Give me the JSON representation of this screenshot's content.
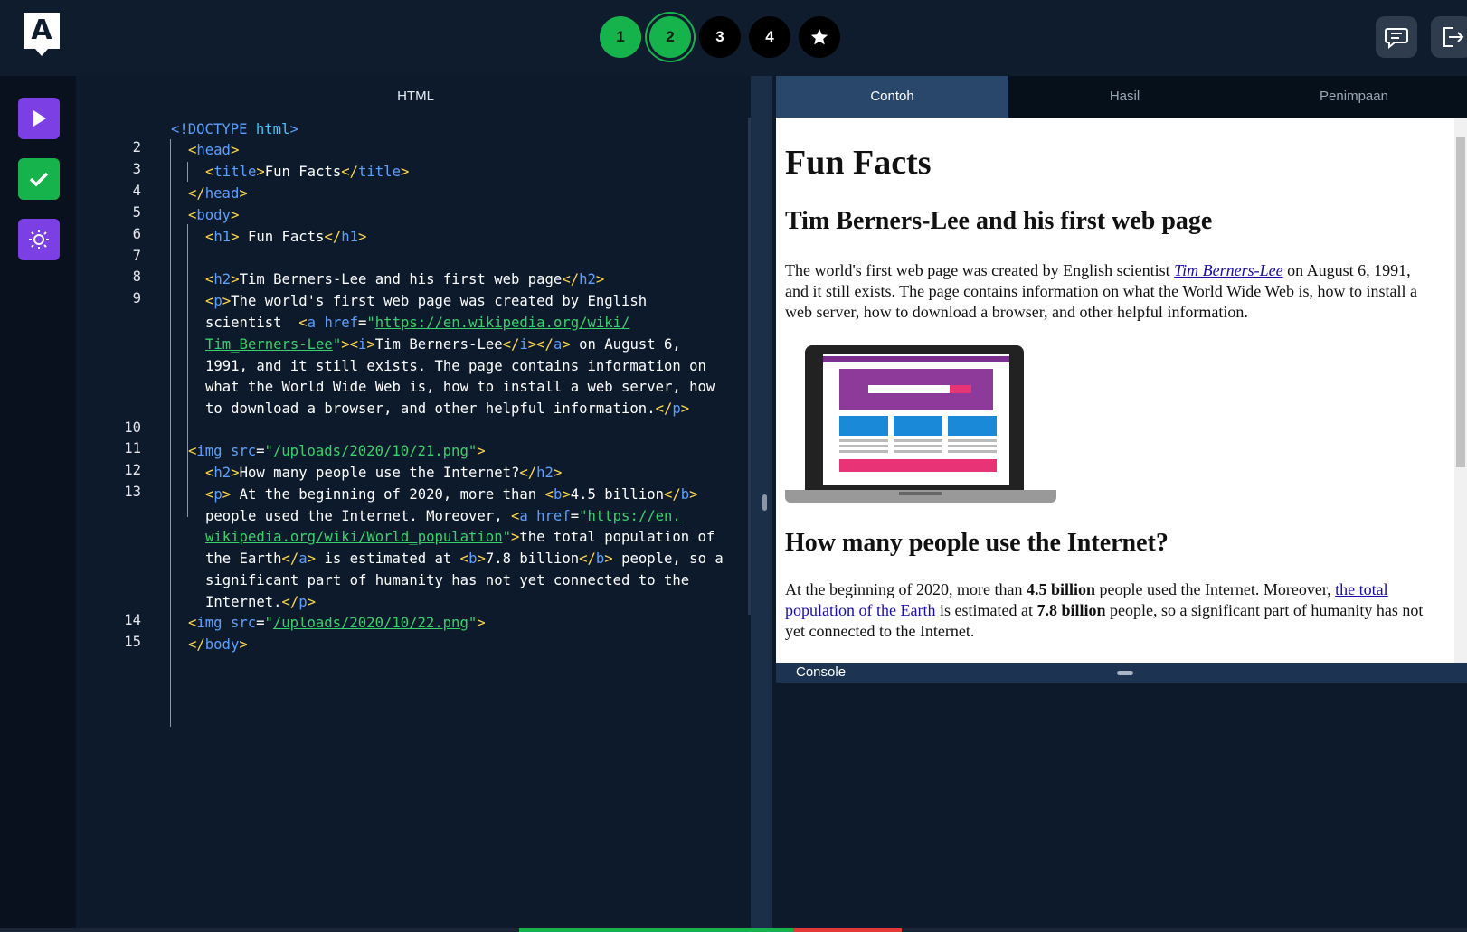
{
  "app": {
    "logo_letter": "A"
  },
  "steps": [
    {
      "label": "1",
      "state": "done"
    },
    {
      "label": "2",
      "state": "current"
    },
    {
      "label": "3",
      "state": "locked"
    },
    {
      "label": "4",
      "state": "locked"
    },
    {
      "label": "",
      "icon": "star-icon",
      "state": "locked"
    }
  ],
  "top_actions": [
    {
      "icon": "chat-icon"
    },
    {
      "icon": "logout-icon"
    }
  ],
  "rail": [
    {
      "icon": "play-icon",
      "color": "#7b3fe4"
    },
    {
      "icon": "check-icon",
      "color": "#16b24b"
    },
    {
      "icon": "sun-icon",
      "color": "#7b3fe4"
    }
  ],
  "editor": {
    "title": "HTML",
    "line_numbers": [
      "2",
      "3",
      "4",
      "5",
      "6",
      "7",
      "8",
      "9",
      "10",
      "11",
      "12",
      "13",
      "14",
      "15"
    ]
  },
  "tabs": {
    "example": "Contoh",
    "result": "Hasil",
    "saving": "Penimpaan"
  },
  "preview": {
    "h1": "Fun Facts",
    "h2_first": "Tim Berners-Lee and his first web page",
    "p1_before": "The world's first web page was created by English scientist ",
    "p1_link": "Tim Berners-Lee",
    "p1_after": " on August 6, 1991, and it still exists. The page contains information on what the World Wide Web is, how to install a web server, how to download a browser, and other helpful information.",
    "h2_second": "How many people use the Internet?",
    "p2_a": "At the beginning of 2020, more than ",
    "p2_b1": "4.5 billion",
    "p2_c": " people used the Internet. Moreover, ",
    "p2_link": "the total population of the Earth",
    "p2_d": " is estimated at ",
    "p2_b2": "7.8 billion",
    "p2_e": " people, so a significant part of humanity has not yet connected to the Internet."
  },
  "console": {
    "label": "Console"
  },
  "progress": {
    "green_fraction": 0.187,
    "red_fraction": 0.074
  }
}
